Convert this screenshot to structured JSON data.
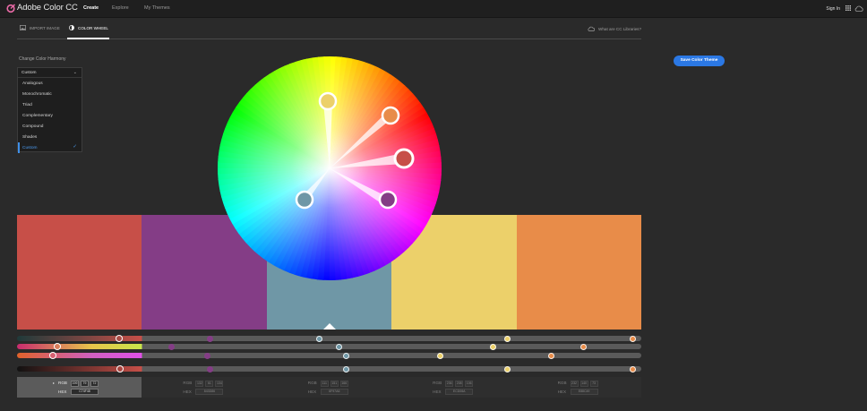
{
  "app": {
    "title": "Adobe Color CC"
  },
  "nav": {
    "items": [
      "Create",
      "Explore",
      "My Themes"
    ],
    "signin": "Sign In"
  },
  "tabs": {
    "import_image": "IMPORT IMAGE",
    "color_wheel": "COLOR WHEEL",
    "libraries": "What are CC Libraries?"
  },
  "harmony": {
    "label": "Change Color Harmony",
    "current": "Custom",
    "options": [
      "Analogous",
      "Monochromatic",
      "Triad",
      "Complementary",
      "Compound",
      "Shades",
      "Custom"
    ],
    "selected_option": "Custom"
  },
  "buttons": {
    "save": "Save Color Theme"
  },
  "colors": {
    "accent": "#2b78e4",
    "swatches": [
      "#c74f48",
      "#843d86",
      "#6f97a6",
      "#ecd06a",
      "#e88c49"
    ]
  },
  "values": {
    "rgb_label": "RGB",
    "hex_label": "HEX",
    "cells": [
      {
        "rgb": [
          "199",
          "79",
          "72"
        ],
        "hex": "C74F48"
      },
      {
        "rgb": [
          "132",
          "61",
          "134"
        ],
        "hex": "843D86"
      },
      {
        "rgb": [
          "111",
          "151",
          "166"
        ],
        "hex": "6F97A6"
      },
      {
        "rgb": [
          "236",
          "208",
          "106"
        ],
        "hex": "ECD06A"
      },
      {
        "rgb": [
          "232",
          "140",
          "73"
        ],
        "hex": "E88C49"
      }
    ]
  },
  "icons": [
    "adobe-logo-icon",
    "apps-grid-icon",
    "creative-cloud-icon",
    "image-icon",
    "color-wheel-icon",
    "cloud-icon",
    "chevron-down-icon",
    "checkmark-icon",
    "play-arrow-icon"
  ]
}
